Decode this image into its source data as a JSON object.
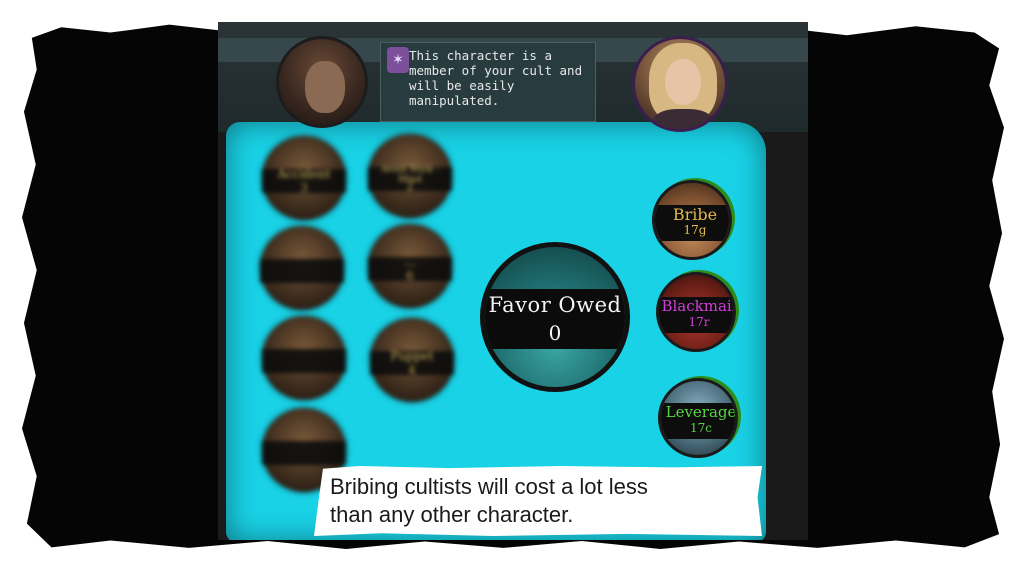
{
  "tooltip": {
    "text": "This character is a member of your cult and will be easily manipulated."
  },
  "tokens": [
    {
      "label": "Accident",
      "value": "3"
    },
    {
      "label": "Avoid Work - Mind",
      "value": "2"
    },
    {
      "label": "",
      "value": ""
    },
    {
      "label": "...",
      "value": "6"
    },
    {
      "label": "",
      "value": ""
    },
    {
      "label": "Puppet",
      "value": "4"
    },
    {
      "label": "",
      "value": ""
    }
  ],
  "favor": {
    "title": "Favor Owed",
    "value": "0"
  },
  "actions": {
    "bribe": {
      "label": "Bribe",
      "cost": "17g",
      "color": "#e2b94a"
    },
    "blackmail": {
      "label": "Blackmail",
      "cost": "17r",
      "color": "#d23ed8"
    },
    "leverage": {
      "label": "Leverage",
      "cost": "17c",
      "color": "#55d645"
    }
  },
  "caption": {
    "line1": "Bribing cultists will cost a lot less",
    "line2": "than any other character."
  }
}
